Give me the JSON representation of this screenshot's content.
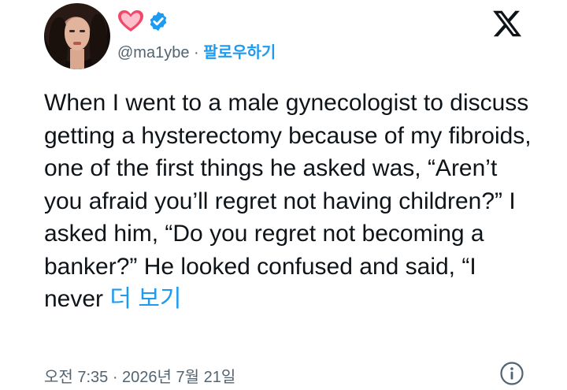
{
  "header": {
    "handle": "@ma1ybe",
    "separator": "·",
    "follow_label": "팔로우하기",
    "icons": [
      "heart-emoji-icon",
      "verified-badge-icon",
      "x-logo-icon"
    ],
    "colors": {
      "accent": "#1d9bf0",
      "secondary_text": "#536471",
      "heart": "#f04a6b"
    }
  },
  "tweet": {
    "text": "When I went to a male gynecologist to discuss getting a hysterectomy because of my fibroids, one of the first things he asked was, “Aren’t you afraid you’ll regret not having children?” I asked him, “Do you regret not becoming a banker?” He looked confused and said, “I never",
    "more_label": "더 보기"
  },
  "footer": {
    "timestamp": "오전 7:35 · 2026년 7월 21일",
    "icon": "info-icon"
  }
}
